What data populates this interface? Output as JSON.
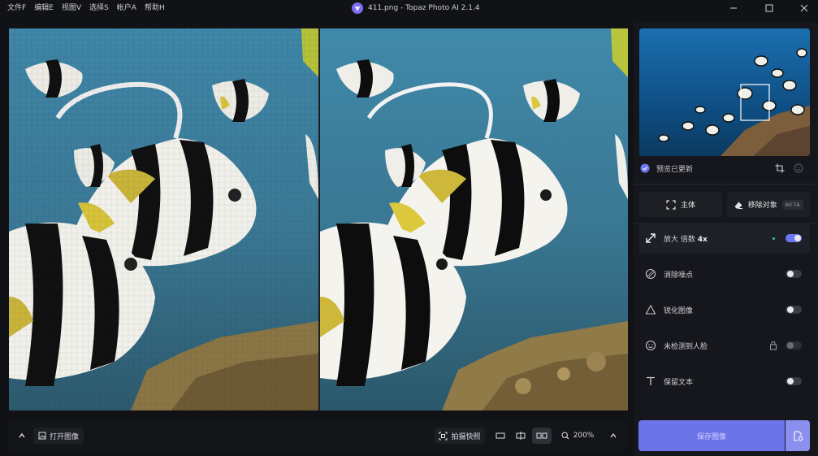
{
  "menu": [
    "文件F",
    "编辑E",
    "视图V",
    "选择S",
    "帐户A",
    "帮助H"
  ],
  "window": {
    "title": "411.png - Topaz Photo AI 2.1.4"
  },
  "right_panel": {
    "preview_status": "预览已更新",
    "modes": {
      "subject": "主体",
      "remove": "移除对象",
      "beta_badge": "BETA"
    },
    "features": {
      "upscale": {
        "label": "放大 倍数",
        "value": "4x",
        "enabled": true
      },
      "denoise": {
        "label": "消除噪点",
        "enabled": false
      },
      "sharpen": {
        "label": "锐化图像",
        "enabled": false
      },
      "face": {
        "label": "未检测到人脸",
        "enabled": false,
        "locked": true
      },
      "text": {
        "label": "保留文本",
        "enabled": false
      }
    },
    "save_label": "保存图像"
  },
  "toolbar": {
    "open_label": "打开图像",
    "snapshot_label": "拍摄快照",
    "zoom": "200%"
  },
  "colors": {
    "accent": "#6b78f4",
    "save": "#6d74e8",
    "active_dot": "#3bcf7a"
  }
}
